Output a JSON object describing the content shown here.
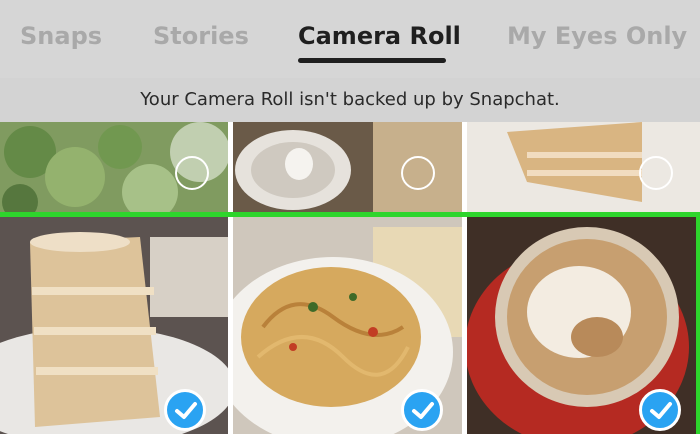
{
  "tabs": {
    "snaps": "Snaps",
    "stories": "Stories",
    "camera_roll": "Camera Roll",
    "my_eyes_only": "My Eyes Only",
    "active": "Camera Roll"
  },
  "notice": "Your Camera Roll isn't backed up by Snapchat.",
  "photos": [
    {
      "subject": "broccoli",
      "selected": false
    },
    {
      "subject": "coffee cup",
      "selected": false
    },
    {
      "subject": "cake slice",
      "selected": false
    },
    {
      "subject": "cake slice",
      "selected": true
    },
    {
      "subject": "spaghetti",
      "selected": true
    },
    {
      "subject": "latte",
      "selected": true
    }
  ],
  "colors": {
    "selection_border": "#2ed52c",
    "checkmark_badge": "#2aa3f2",
    "active_tab": "#1f1f1f",
    "inactive_tab": "#a9a9a9"
  }
}
